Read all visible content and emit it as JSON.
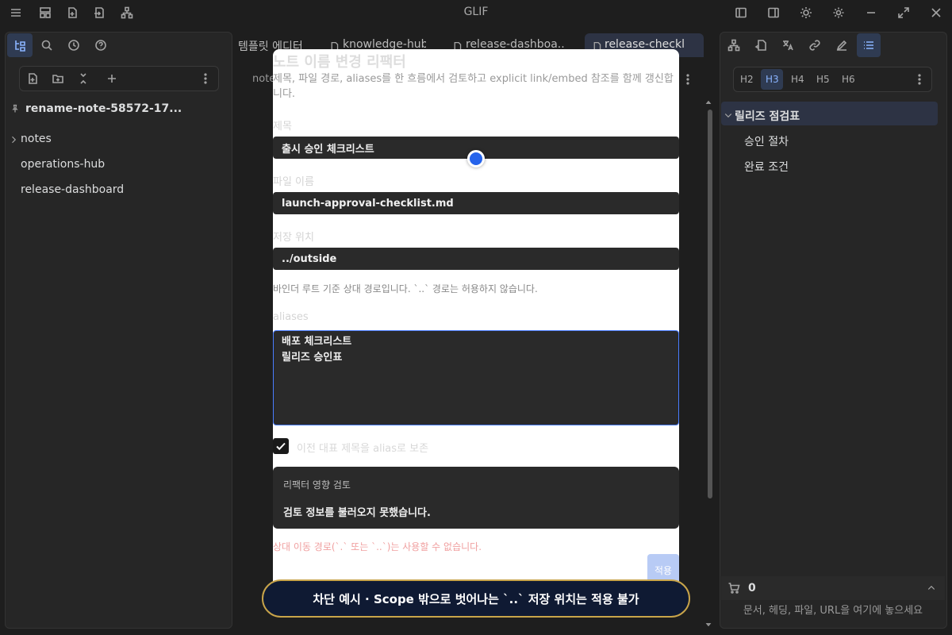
{
  "app": {
    "title": "GLIF"
  },
  "left_panel": {
    "vault_name": "rename-note-58572-17...",
    "tree": [
      {
        "label": "notes",
        "folder": true
      },
      {
        "label": "operations-hub",
        "folder": false
      },
      {
        "label": "release-dashboard",
        "folder": false
      }
    ]
  },
  "tabs": [
    {
      "label": "템플릿 에디터"
    },
    {
      "label": "knowledge-hub"
    },
    {
      "label": "release-dashboa..."
    },
    {
      "label": "release-checkli..."
    }
  ],
  "editor": {
    "description_fragment": "note"
  },
  "modal": {
    "title": "노트 이름 변경 리팩터",
    "description": "제목, 파일 경로, aliases를 한 흐름에서 검토하고 explicit link/embed 참조를 함께 갱신합니다.",
    "title_label": "제목",
    "title_value": "출시 승인 체크리스트",
    "filename_label": "파일 이름",
    "filename_value": "launch-approval-checklist.md",
    "location_label": "저장 위치",
    "location_value": "../outside",
    "location_hint": "바인더 루트 기준 상대 경로입니다. `..` 경로는 허용하지 않습니다.",
    "aliases_label": "aliases",
    "aliases_value": "배포 체크리스트\n릴리즈 승인표",
    "keep_alias_label": "이전 대표 제목을 alias로 보존",
    "review_title": "리팩터 영향 검토",
    "review_message": "검토 정보를 불러오지 못했습니다.",
    "error_message": "상대 이동 경로(`.` 또는 `..`)는 사용할 수 없습니다.",
    "apply_label": "적용"
  },
  "banner": {
    "text": "차단 예시 · Scope 밖으로 벗어나는 `..` 저장 위치는 적용 불가"
  },
  "right_panel": {
    "heading_levels": [
      "H2",
      "H3",
      "H4",
      "H5",
      "H6"
    ],
    "outline": {
      "root": "릴리즈 점검표",
      "children": [
        "승인 절차",
        "완료 조건"
      ]
    },
    "cart_count": "0",
    "drop_placeholder": "문서, 헤딩, 파일, URL을 여기에 놓으세요"
  },
  "colors": {
    "accent": "#2563eb",
    "banner_border": "#c8a44a",
    "error": "#f0a0a0"
  }
}
